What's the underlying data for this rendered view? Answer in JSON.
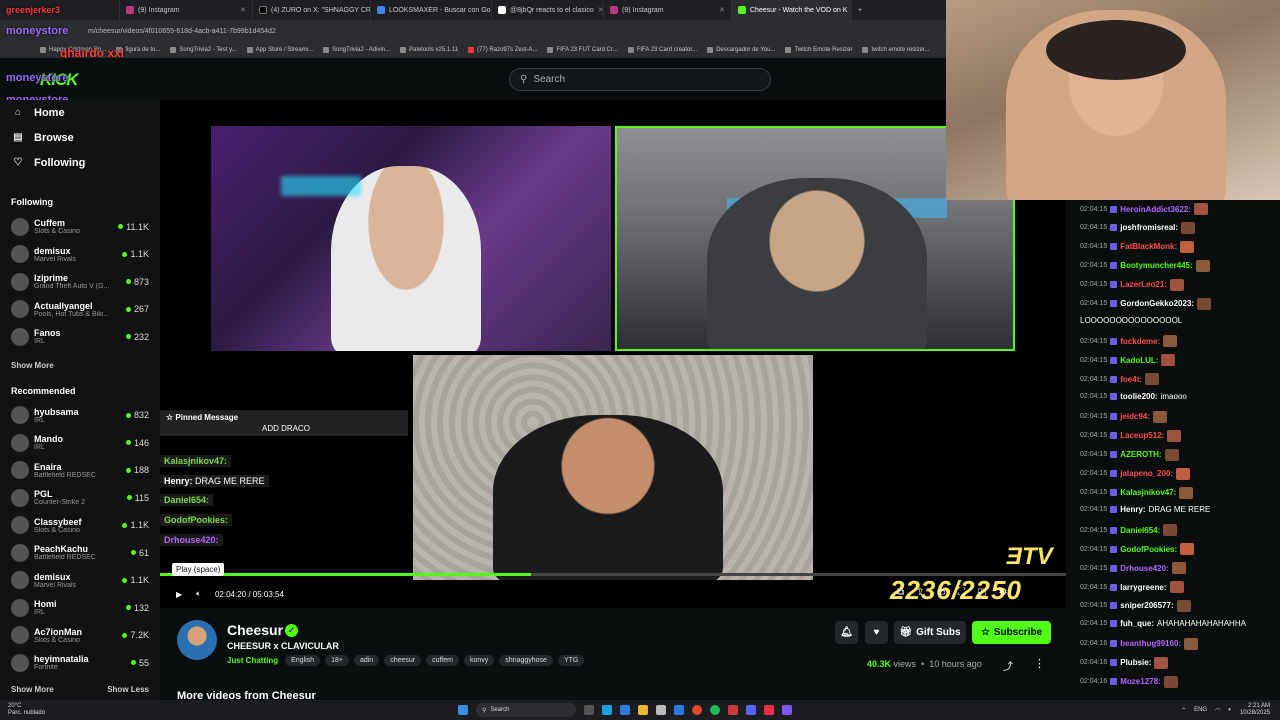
{
  "browser": {
    "tabs": [
      {
        "label": "(9) Instagram"
      },
      {
        "label": "(4) ZURO on X: \"SHNAGGY CR"
      },
      {
        "label": "LOOKSMAXER - Buscar con Go"
      },
      {
        "label": "@8jbQr reacts to el clasico"
      },
      {
        "label": "(9) Instagram"
      },
      {
        "label": "Cheesur - Watch the VOD on K"
      }
    ],
    "url": "m/cheesur/videos/4f010655-618d-4acb-a411-7b99b1d454d2",
    "bookmarks": [
      "Happy Cristmen Ro...",
      "figura de to...",
      "SongTrivia2 - Test y...",
      "App Store / Streami...",
      "SongTrivia2 - Adivin...",
      "Paletools v25.1.11",
      "(77) Razo97s Zest-A...",
      "FIFA 23 FUT Card Cr...",
      "FIFA 23 Card creator...",
      "Descargador de You...",
      "Twitch Emote Resizer",
      "twitch emote resizer..."
    ]
  },
  "overlay_top": {
    "line1": "greenjerker3",
    "line2": "moneystore",
    "line3": "ghairdo xxl",
    "line4": "moneystore",
    "line5": "moneystore"
  },
  "header": {
    "logo": "KICK",
    "search_placeholder": "Search"
  },
  "sidebar": {
    "nav": [
      {
        "label": "Home",
        "icon": "home-icon"
      },
      {
        "label": "Browse",
        "icon": "browse-icon"
      },
      {
        "label": "Following",
        "icon": "heart-icon"
      }
    ],
    "following_title": "Following",
    "following": [
      {
        "name": "Cuffem",
        "category": "Slots & Casino",
        "viewers": "11.1K"
      },
      {
        "name": "demisux",
        "category": "Marvel Rivals",
        "viewers": "1.1K"
      },
      {
        "name": "lziprime",
        "category": "Grand Theft Auto V (G...",
        "viewers": "873"
      },
      {
        "name": "Actuallyangel",
        "category": "Pools, Hot Tubs & Biki...",
        "viewers": "267"
      },
      {
        "name": "Fanos",
        "category": "IRL",
        "viewers": "232"
      }
    ],
    "show_more": "Show More",
    "recommended_title": "Recommended",
    "recommended": [
      {
        "name": "hyubsama",
        "category": "IRL",
        "viewers": "832"
      },
      {
        "name": "Mando",
        "category": "IRL",
        "viewers": "146"
      },
      {
        "name": "Enaira",
        "category": "Battlefield REDSEC",
        "viewers": "188"
      },
      {
        "name": "PGL",
        "category": "Counter-Strike 2",
        "viewers": "115"
      },
      {
        "name": "Classybeef",
        "category": "Slots & Casino",
        "viewers": "1.1K"
      },
      {
        "name": "PeachKachu",
        "category": "Battlefield REDSEC",
        "viewers": "61"
      },
      {
        "name": "demisux",
        "category": "Marvel Rivals",
        "viewers": "1.1K"
      },
      {
        "name": "Homi",
        "category": "IRL",
        "viewers": "132"
      },
      {
        "name": "Ac7ionMan",
        "category": "Slots & Casino",
        "viewers": "7.2K"
      },
      {
        "name": "heyimnatalia",
        "category": "Fortnite",
        "viewers": "55"
      }
    ],
    "show_more_bottom": "Show More",
    "show_less": "Show Less"
  },
  "player": {
    "pinned_title": "Pinned Message",
    "pinned_msg": "ADD DRACO",
    "overlay_chat": [
      {
        "user": "Kalasjnikov47:",
        "msg": ""
      },
      {
        "user": "Henry:",
        "msg": "DRAG ME RERE"
      },
      {
        "user": "Daniel654:",
        "msg": ""
      },
      {
        "user": "GodofPookies:",
        "msg": ""
      },
      {
        "user": "Drhouse420:",
        "msg": ""
      }
    ],
    "tooltip": "Play (space)",
    "time_current": "02:04:20",
    "time_total": "05:03:54",
    "progress": 0.41,
    "vod_score": "2236/2250"
  },
  "stream": {
    "name": "Cheesur",
    "title": "CHEESUR x CLAVICULAR",
    "category": "Just Chatting",
    "tags": [
      "English",
      "18+",
      "adin",
      "cheesur",
      "cuffem",
      "konvy",
      "shnaggyhose",
      "YTG"
    ],
    "gift_subs": "Gift Subs",
    "subscribe": "Subscribe",
    "views_count": "40.3K",
    "views_label": "views",
    "time_ago": "10 hours ago",
    "more_videos": "More videos from Cheesur"
  },
  "chat": [
    {
      "ts": "02:04:15",
      "user": "HeroinAddict3622:",
      "msg": "",
      "color": "#b565ff"
    },
    {
      "ts": "02:04:15",
      "user": "joshfromisreal:",
      "msg": "",
      "color": "#ffffff"
    },
    {
      "ts": "02:04:15",
      "user": "FatBlackMonk:",
      "msg": "",
      "color": "#ff4f4f"
    },
    {
      "ts": "02:04:15",
      "user": "Bootymuncher445:",
      "msg": "",
      "color": "#53fc18"
    },
    {
      "ts": "02:04:15",
      "user": "LazerLeo21:",
      "msg": "",
      "color": "#ff4f4f"
    },
    {
      "ts": "02:04:15",
      "user": "GordonGekko2023:",
      "msg": "",
      "color": "#ffffff"
    },
    {
      "ts": "",
      "user": "",
      "msg": "LOOOOOOOOOOOOOOOL",
      "color": "#ffffff"
    },
    {
      "ts": "02:04:15",
      "user": "fuckdeme:",
      "msg": "",
      "color": "#ff4f4f"
    },
    {
      "ts": "02:04:15",
      "user": "KadoLUL:",
      "msg": "",
      "color": "#53fc18"
    },
    {
      "ts": "02:04:15",
      "user": "foe4t:",
      "msg": "",
      "color": "#ff4f4f"
    },
    {
      "ts": "02:04:15",
      "user": "toolie200:",
      "msg": "imaooo",
      "color": "#ffffff"
    },
    {
      "ts": "02:04:15",
      "user": "jeidc94:",
      "msg": "",
      "color": "#ff4f4f"
    },
    {
      "ts": "02:04:15",
      "user": "Laceup512:",
      "msg": "",
      "color": "#ff4f4f"
    },
    {
      "ts": "02:04:15",
      "user": "AZEROTH:",
      "msg": "",
      "color": "#53fc18"
    },
    {
      "ts": "02:04:15",
      "user": "jalapeno_200:",
      "msg": "",
      "color": "#ff4f4f"
    },
    {
      "ts": "02:04:15",
      "user": "Kalasjnikov47:",
      "msg": "",
      "color": "#53fc18"
    },
    {
      "ts": "02:04:15",
      "user": "Henry:",
      "msg": "DRAG ME RERE",
      "color": "#ffffff"
    },
    {
      "ts": "02:04:15",
      "user": "Daniel654:",
      "msg": "",
      "color": "#53fc18"
    },
    {
      "ts": "02:04:15",
      "user": "GodofPookies:",
      "msg": "",
      "color": "#53fc18"
    },
    {
      "ts": "02:04:15",
      "user": "Drhouse420:",
      "msg": "",
      "color": "#b565ff"
    },
    {
      "ts": "02:04:15",
      "user": "larrygreene:",
      "msg": "",
      "color": "#ffffff"
    },
    {
      "ts": "02:04:15",
      "user": "sniper206577:",
      "msg": "",
      "color": "#ffffff"
    },
    {
      "ts": "02:04:15",
      "user": "fuh_que:",
      "msg": "AHAHAHAHAHAHAHHA",
      "color": "#ffffff"
    },
    {
      "ts": "02:04:16",
      "user": "beanthug99160:",
      "msg": "",
      "color": "#b565ff"
    },
    {
      "ts": "02:04:16",
      "user": "Plubsie:",
      "msg": "",
      "color": "#ffffff"
    },
    {
      "ts": "02:04:16",
      "user": "Moze1278:",
      "msg": "",
      "color": "#b565ff"
    }
  ],
  "taskbar": {
    "weather_temp": "20°C",
    "weather_desc": "Parc. nublado",
    "search": "Search",
    "lang": "ENG",
    "time": "2:21 AM",
    "date": "10/28/2025"
  }
}
